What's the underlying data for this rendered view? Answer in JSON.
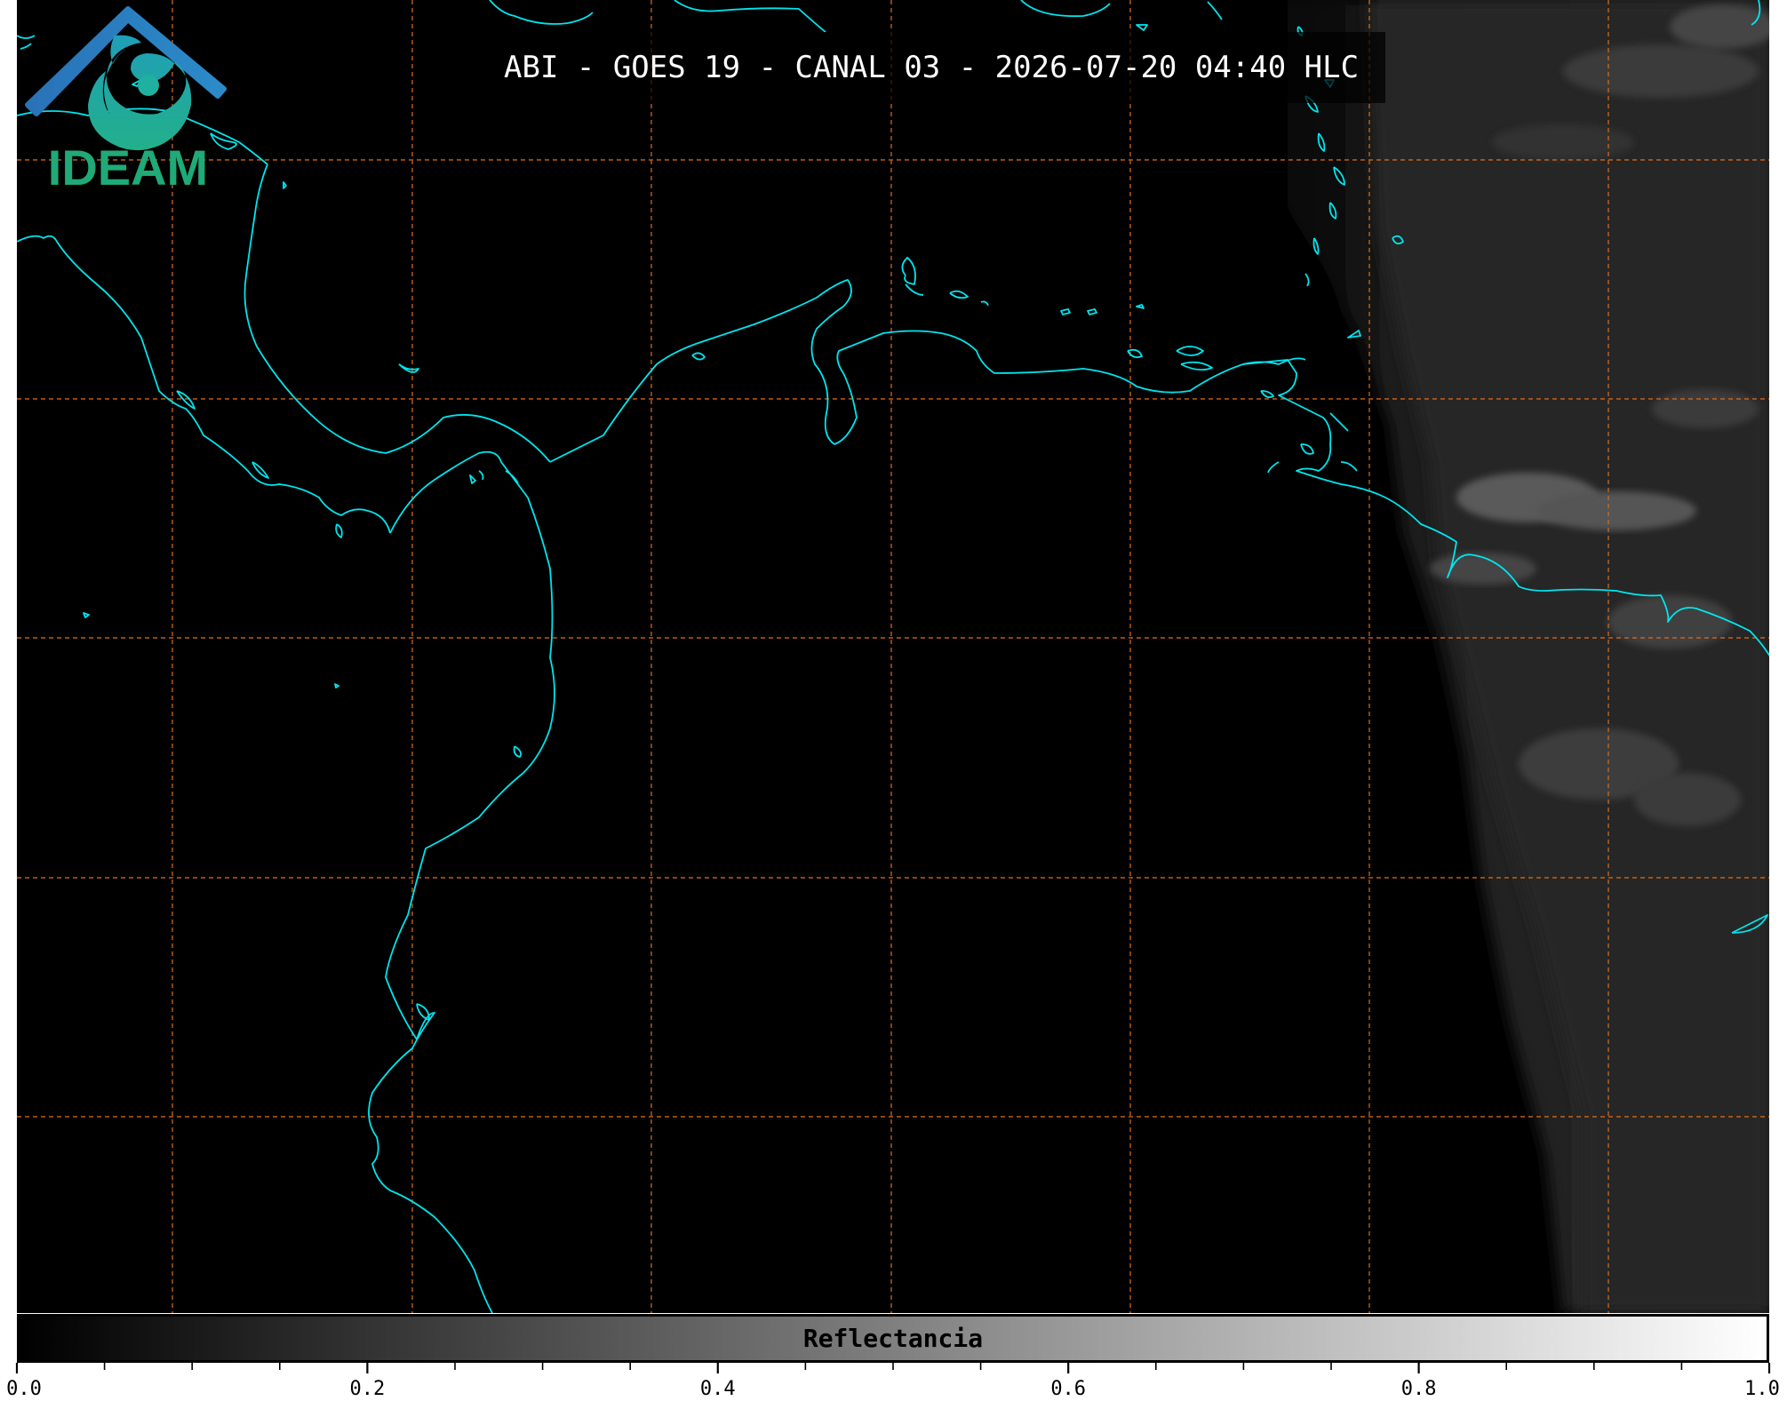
{
  "title": "ABI - GOES 19 - CANAL 03 - 2026-07-20 04:40 HLC",
  "logo": {
    "icon": "ideam-logo-icon",
    "text": "IDEAM",
    "colors": {
      "roof": "#2a72b8",
      "swirl": "#1faa8a",
      "text": "#1faa78"
    }
  },
  "colorbar": {
    "label": "Reflectancia",
    "min": 0.0,
    "max": 1.0,
    "major_ticks": [
      "0.0",
      "0.2",
      "0.4",
      "0.6",
      "0.8",
      "1.0"
    ],
    "minor_tick_count": 20,
    "colors": {
      "low": "#000000",
      "high": "#ffffff"
    }
  },
  "colors": {
    "background": "#000000",
    "coastline": "#00e5ee",
    "graticule": "#d2691e"
  }
}
